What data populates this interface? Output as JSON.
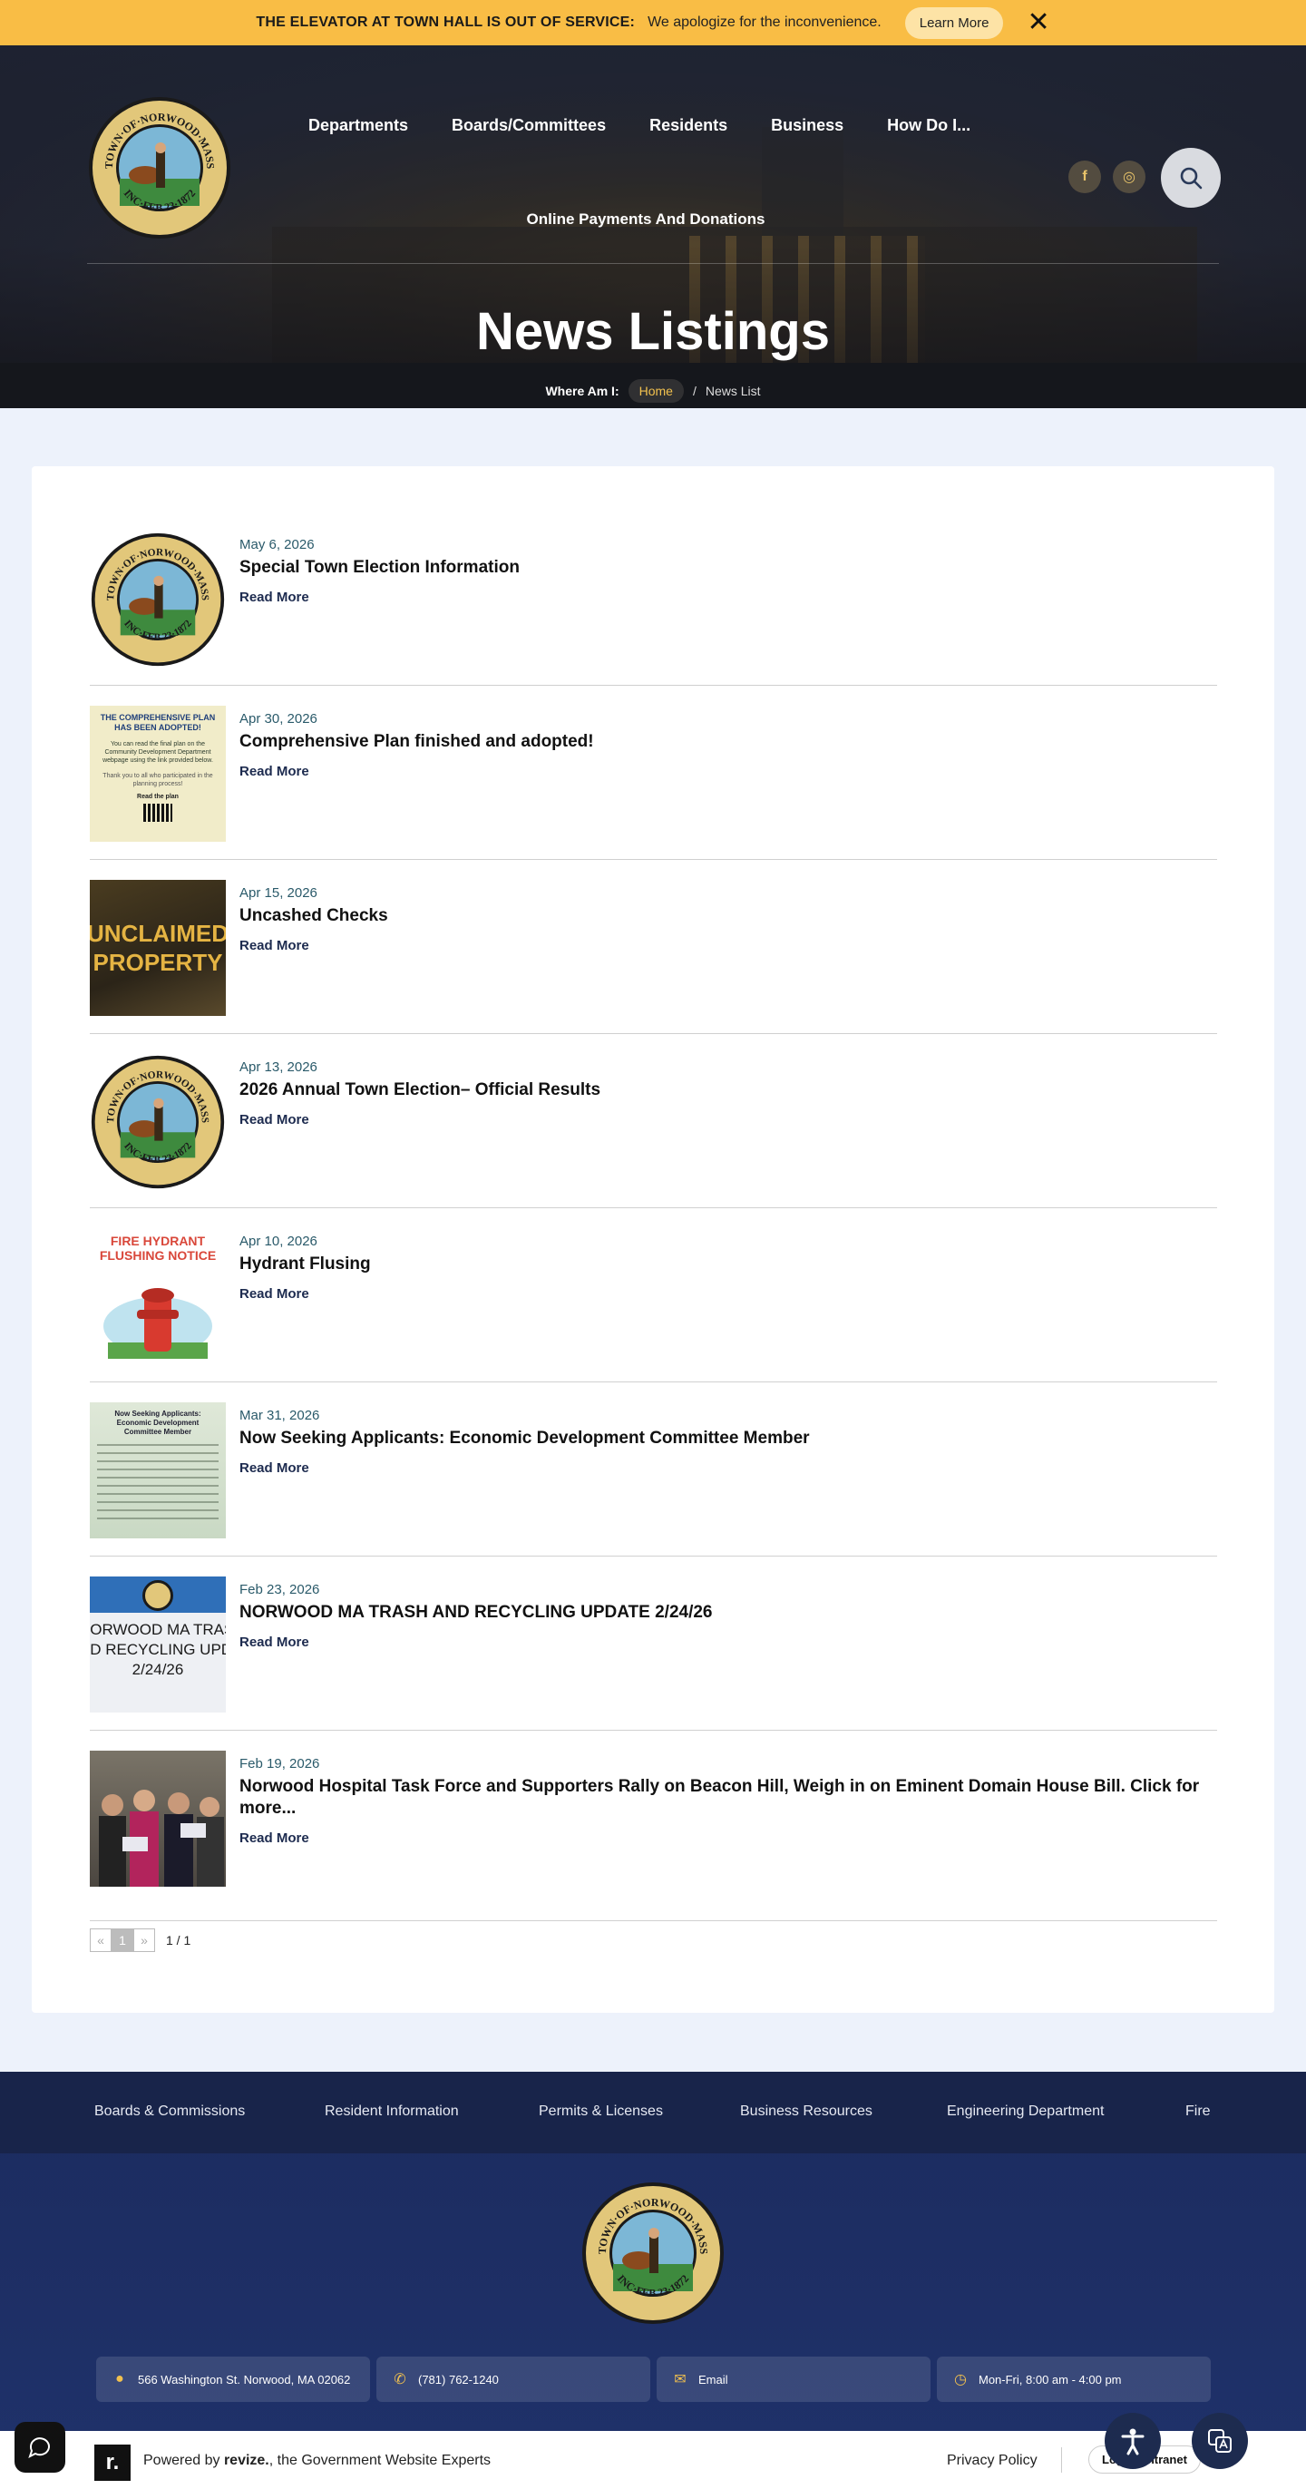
{
  "alert": {
    "title": "THE ELEVATOR AT TOWN HALL IS OUT OF SERVICE:",
    "message": "We apologize for the inconvenience.",
    "learn_more": "Learn More",
    "close": "✕"
  },
  "header": {
    "nav": [
      "Departments",
      "Boards/Committees",
      "Residents",
      "Business",
      "How Do I..."
    ],
    "nav_secondary": "Online Payments And Donations",
    "social": {
      "facebook": "f",
      "instagram": "◎"
    },
    "icons": {
      "search": "search-icon"
    }
  },
  "hero": {
    "title": "News Listings",
    "breadcrumb_label": "Where Am I:",
    "breadcrumb_home": "Home",
    "breadcrumb_sep": "/",
    "breadcrumb_current": "News List"
  },
  "seal": {
    "top_text": "TOWN·OF·NORWOOD·MASS",
    "bottom_text": "INC·FEB 23·1872"
  },
  "news": [
    {
      "date": "May 6, 2026",
      "title": "Special Town Election Information",
      "read_more": "Read More",
      "thumb": "seal"
    },
    {
      "date": "Apr 30, 2026",
      "title": "Comprehensive Plan finished and adopted!",
      "read_more": "Read More",
      "thumb": "plan",
      "thumb_text": {
        "head": "THE COMPREHENSIVE PLAN HAS BEEN ADOPTED!",
        "body": "You can read the final plan on the Community Development Department webpage using the link provided below.",
        "thanks": "Thank you to all who participated in the planning process!",
        "cta": "Read the plan"
      }
    },
    {
      "date": "Apr 15, 2026",
      "title": "Uncashed Checks",
      "read_more": "Read More",
      "thumb": "unclaimed",
      "thumb_text": {
        "line1": "UNCLAIMED",
        "line2": "PROPERTY"
      }
    },
    {
      "date": "Apr 13, 2026",
      "title": "2026 Annual Town Election– Official Results",
      "read_more": "Read More",
      "thumb": "seal"
    },
    {
      "date": "Apr 10, 2026",
      "title": "Hydrant Flusing",
      "read_more": "Read More",
      "thumb": "hydrant",
      "thumb_text": {
        "line1": "FIRE HYDRANT",
        "line2": "FLUSHING NOTICE"
      }
    },
    {
      "date": "Mar 31, 2026",
      "title": "Now Seeking Applicants: Economic Development Committee Member",
      "read_more": "Read More",
      "thumb": "applicants",
      "thumb_text": {
        "head": "Now Seeking Applicants: Economic Development Committee Member"
      }
    },
    {
      "date": "Feb 23, 2026",
      "title": "NORWOOD MA TRASH AND RECYCLING UPDATE 2/24/26",
      "read_more": "Read More",
      "thumb": "trash",
      "thumb_text": {
        "line1": "NORWOOD MA TRASH",
        "line2": "ND RECYCLING UPDAT",
        "line3": "2/24/26"
      }
    },
    {
      "date": "Feb 19, 2026",
      "title": "Norwood Hospital Task Force and Supporters Rally on Beacon Hill, Weigh in on Eminent Domain House Bill.  Click for more...",
      "read_more": "Read More",
      "thumb": "rally"
    }
  ],
  "pagination": {
    "prev": "«",
    "current": "1",
    "next": "»",
    "info": "1 / 1"
  },
  "footer": {
    "links": [
      "Boards & Commissions",
      "Resident Information",
      "Permits & Licenses",
      "Business Resources",
      "Engineering Department",
      "Fire"
    ],
    "address": "566 Washington St. Norwood, MA 02062",
    "phone": "(781) 762-1240",
    "email": "Email",
    "hours": "Mon-Fri, 8:00 am - 4:00 pm",
    "powered_prefix": "Powered by ",
    "powered_brand": "revize.",
    "powered_suffix": ", the Government Website Experts",
    "revize_mark": "r.",
    "privacy": "Privacy Policy",
    "login": "Login",
    "intranet": "Intranet"
  },
  "colors": {
    "alert": "#f9bd45",
    "navy": "#1d2b4f",
    "footer": "#20336d",
    "accent": "#f2c14e"
  }
}
